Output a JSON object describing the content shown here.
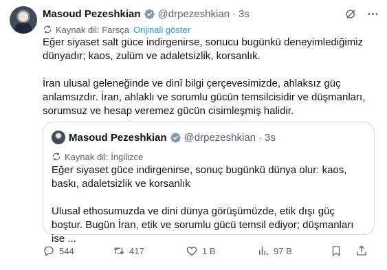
{
  "tweet": {
    "author_name": "Masoud Pezeshkian",
    "handle": "@drpezeshkian",
    "separator": "·",
    "time": "3s",
    "translation": {
      "source_label": "Kaynak dil: Farsça",
      "show_original": "Orijinali göster"
    },
    "paragraphs": [
      "Eğer siyaset salt güce indirgenirse, sonucu bugünkü deneyimlediğimiz dünyadır; kaos, zulüm ve adaletsizlik, korsanlık.",
      "İran ulusal geleneğinde ve dinî bilgi çerçevesimizde, ahlaksız güç anlamsızdır. İran, ahlaklı ve sorumlu gücün temsilcisidir ve düşmanları, sorumsuz ve hesap veremez gücün cisimleşmiş halidir."
    ]
  },
  "quote": {
    "author_name": "Masoud Pezeshkian",
    "handle": "@drpezeshkian",
    "separator": "·",
    "time": "3s",
    "source_label": "Kaynak dil: İngilizce",
    "paragraphs": [
      "Eğer siyaset güce indirgenirse, sonuç bugünkü dünya olur: kaos, baskı, adaletsizlik ve korsanlık",
      "Ulusal ethosumuzda ve dini dünya görüşümüzde, etik dışı güç boştur. Bugün İran, etik ve sorumlu gücü temsil ediyor; düşmanları ise ..."
    ]
  },
  "actions": {
    "replies": "544",
    "reposts": "417",
    "likes": "1 B",
    "views": "97 B"
  },
  "colors": {
    "link": "#1d9bf0",
    "verified": "#829aab",
    "muted": "#536471",
    "border": "#cfd9de"
  },
  "icons": [
    "verified-badge-icon",
    "grok-icon",
    "more-icon",
    "translate-icon",
    "reply-icon",
    "repost-icon",
    "like-icon",
    "views-icon",
    "bookmark-icon",
    "share-icon"
  ]
}
